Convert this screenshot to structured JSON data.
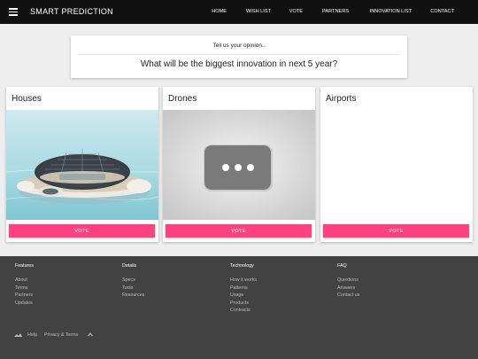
{
  "header": {
    "brand": "SMART PREDICTION",
    "menu_icon": "hamburger-menu-icon",
    "nav": [
      "HOME",
      "WISH LIST",
      "VOTE",
      "PARTNERS",
      "INNOVATION LIST",
      "CONTACT"
    ]
  },
  "question": {
    "prompt": "Tell us your opinion..",
    "text": "What will be the biggest innovation in next 5 year?"
  },
  "cards": [
    {
      "title": "Houses",
      "vote_label": "VOTE",
      "media": "floating-solar-house-image"
    },
    {
      "title": "Drones",
      "vote_label": "VOTE",
      "media": "video-loading-placeholder"
    },
    {
      "title": "Airports",
      "vote_label": "VOTE",
      "media": "blank"
    }
  ],
  "footer": {
    "columns": [
      {
        "heading": "Features",
        "links": [
          "About",
          "Terms",
          "Partners",
          "Updates"
        ]
      },
      {
        "heading": "Details",
        "links": [
          "Specs",
          "Tools",
          "Resources"
        ]
      },
      {
        "heading": "Technology",
        "links": [
          "How it works",
          "Patterns",
          "Usage",
          "Products",
          "Contracts"
        ]
      },
      {
        "heading": "FAQ",
        "links": [
          "Questions",
          "Answers",
          "Contact us"
        ]
      }
    ],
    "bottom": {
      "logo_icon": "logo-icon",
      "help": "Help",
      "privacy": "Privacy & Terms",
      "up_icon": "chevron-up-icon"
    }
  },
  "colors": {
    "topbar": "#111111",
    "accent": "#ff4081",
    "footer": "#424242",
    "background": "#eeeeee"
  }
}
